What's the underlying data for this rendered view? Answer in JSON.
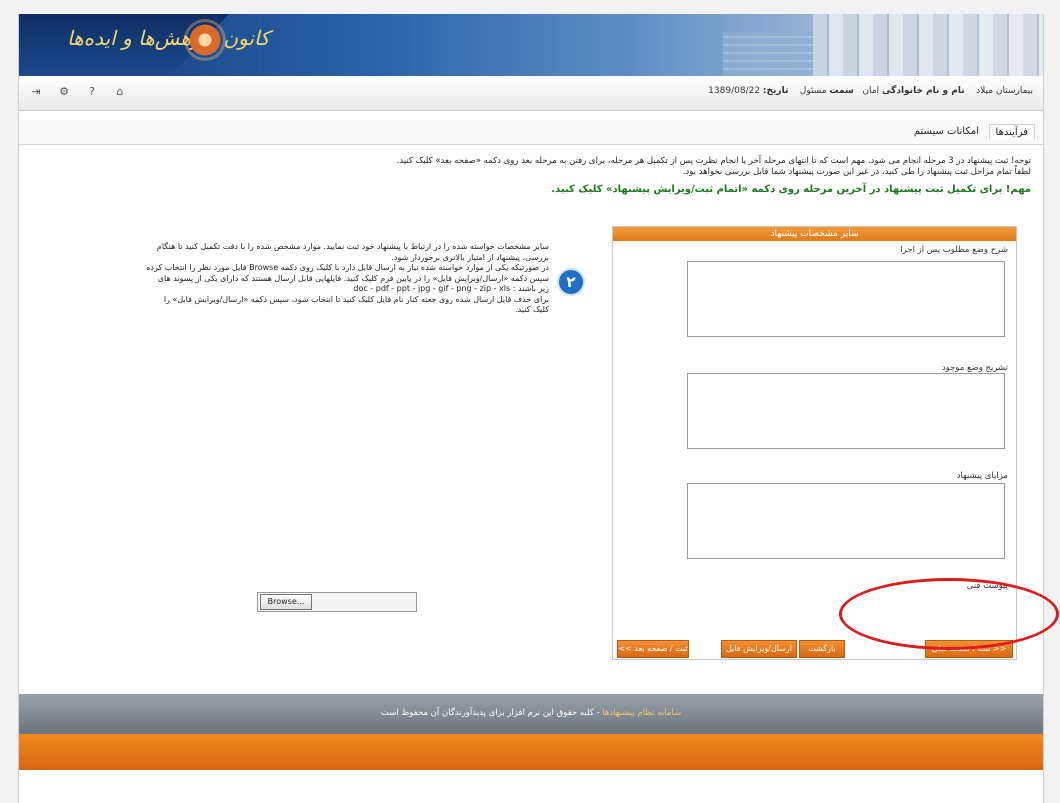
{
  "banner": {
    "logo_text": "کانون پژوهش‌ها و ایده‌ها",
    "colors": {
      "primary": "#123a78",
      "accent": "#f5d86b"
    }
  },
  "toolbar": {
    "icons": [
      "logout-icon",
      "settings-icon",
      "help-icon",
      "home-icon"
    ]
  },
  "user_info": {
    "org": "بیمارستان میلاد",
    "name_label": "نام و نام خانوادگی",
    "name": "امان",
    "post_label": "سمت",
    "post": "مسئول",
    "date_label": "تاریخ:",
    "date": "1389/08/22"
  },
  "tabs": [
    {
      "label": "فرآیندها"
    },
    {
      "label": "امکانات سیستم"
    }
  ],
  "notes": {
    "line1": "توجه! ثبت پیشنهاد در 3 مرحله انجام می شود. مهم است که تا انتهای مرحله آخر یا انجام نظرت پس از تکمیل هر مرحله، برای رفتن به مرحله بعد روی دکمه «صفحه بعد» کلیک کنید.",
    "line2": "لطفاً تمام مراحل ثبت پیشنهاد را طی کنید، در غیر این صورت پیشنهاد شما قابل بررسی نخواهد بود.",
    "line3": "مهم! برای تکمیل ثبت پیشنهاد در آخرین مرحله روی دکمه «اتمام ثبت/ویرایش پیشنهاد» کلیک کنید."
  },
  "form": {
    "header": "سایر مشخصات پیشنهاد",
    "field1_label": "شرح وضع مطلوب پس از اجرا",
    "field2_label": "تشریح وضع موجود",
    "field3_label": "مزایای پیشنهاد",
    "attachment_label": "پیوست فنی",
    "browse_label": "Browse...",
    "buttons": [
      {
        "label": "<< ثبت / صفحه قبلی"
      },
      {
        "label": "بازگشت"
      },
      {
        "label": "ارسال/ویرایش فایل"
      },
      {
        "label": "ثبت / صفحه بعد >>"
      }
    ]
  },
  "help": {
    "badge": "۲",
    "line1": "سایر مشخصات خواسته شده را در ارتباط با پیشنهاد خود ثبت نمایید. موارد مشخص شده را با دقت تکمیل کنید تا هنگام",
    "line2": "بررسی، پیشنهاد از امتیاز بالاتری برخوردار شود.",
    "line3": "در صورتیکه یکی از موارد خواسته شده نیاز به ارسال فایل دارد با کلیک روی دکمه Browse فایل مورد نظر را انتخاب کرده",
    "line4": "سپس دکمه «ارسال/ویرایش فایل» را در پایین فرم کلیک کنید. فایلهایی قابل ارسال هستند که دارای یکی از پسوند های",
    "line5": "زیر باشند : doc - pdf - ppt - jpg - gif - png - zip - xls",
    "line6": "برای حذف فایل ارسال شده روی جعبه کنار نام فایل کلیک کنید تا انتخاب شود، سپس دکمه «ارسال/ویرایش فایل» را",
    "line7": "کلیک کنید."
  },
  "footer": {
    "brand": "سامانه نظام پیشنهادها",
    "text": " - کلیه حقوق این نرم افزار برای پدیدآورندگان آن محفوظ است"
  }
}
